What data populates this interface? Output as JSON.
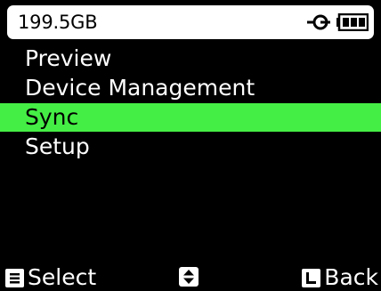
{
  "status_bar": {
    "storage": "199.5GB",
    "power_icon": "power-plug-icon",
    "battery_icon": "battery-full-icon"
  },
  "menu": {
    "items": [
      {
        "label": "Preview",
        "selected": false
      },
      {
        "label": "Device Management",
        "selected": false
      },
      {
        "label": "Sync",
        "selected": true
      },
      {
        "label": "Setup",
        "selected": false
      }
    ]
  },
  "softkeys": {
    "left_label": "Select",
    "right_label": "Back",
    "nav_icon": "up-down-arrow-icon"
  },
  "colors": {
    "background": "#000000",
    "highlight": "#45ee45",
    "status_bar": "#ffffff"
  }
}
